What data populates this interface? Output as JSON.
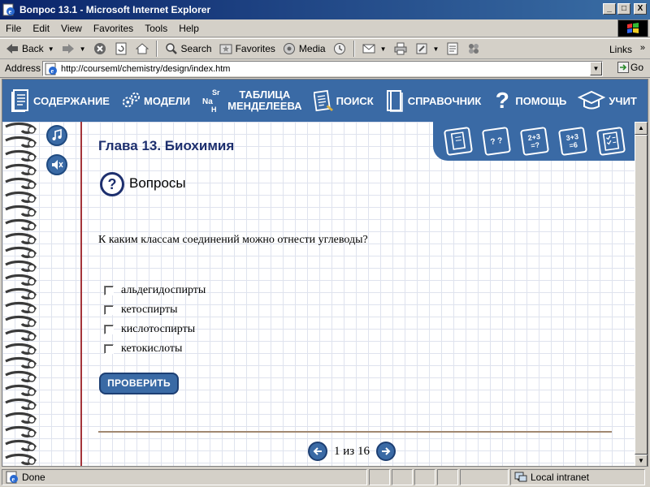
{
  "window": {
    "title": "Вопрос 13.1 - Microsoft Internet Explorer",
    "minimize": "_",
    "maximize": "□",
    "close": "X"
  },
  "menu": {
    "items": [
      "File",
      "Edit",
      "View",
      "Favorites",
      "Tools",
      "Help"
    ]
  },
  "toolbar": {
    "back": "Back",
    "search": "Search",
    "favorites": "Favorites",
    "media": "Media",
    "links": "Links"
  },
  "address": {
    "label": "Address",
    "url": "http://courseml/chemistry/design/index.htm",
    "go": "Go"
  },
  "nav": {
    "contents": "СОДЕРЖАНИЕ",
    "models": "МОДЕЛИ",
    "table_line1": "ТАБЛИЦА",
    "table_line2": "МЕНДЕЛЕЕВА",
    "search": "ПОИСК",
    "reference": "СПРАВОЧНИК",
    "help": "ПОМОЩЬ",
    "teacher": "УЧИТ",
    "elements_icon_text": "Sr Na H"
  },
  "corner_tools": {
    "quiz_icon_text": "? ?",
    "calc1": "2+3 =?",
    "calc2": "3+3 =6"
  },
  "content": {
    "chapter": "Глава 13. Биохимия",
    "section_icon": "?",
    "section": "Вопросы",
    "question": "К каким классам соединений можно отнести углеводы?",
    "options": [
      {
        "label": "альдегидоспирты",
        "checked": false
      },
      {
        "label": "кетоспирты",
        "checked": false
      },
      {
        "label": "кислотоспирты",
        "checked": false
      },
      {
        "label": "кетокислоты",
        "checked": false
      }
    ],
    "check_button": "ПРОВЕРИТЬ",
    "pager_text": "1 из 16",
    "pager_current": 1,
    "pager_total": 16
  },
  "status": {
    "text": "Done",
    "zone": "Local intranet"
  },
  "colors": {
    "accent_blue": "#3a6aa5",
    "heading_navy": "#1d2f6e",
    "margin_red": "#a4343a"
  },
  "icons": [
    "ie-page-icon",
    "back-arrow-icon",
    "forward-arrow-icon",
    "stop-icon",
    "refresh-icon",
    "home-icon",
    "search-icon",
    "favorites-icon",
    "media-icon",
    "history-icon",
    "mail-icon",
    "print-icon",
    "edit-icon",
    "discuss-icon",
    "messenger-icon",
    "book-icon",
    "gears-icon",
    "elements-icon",
    "document-icon",
    "help-question-icon",
    "graduation-cap-icon",
    "music-note-icon",
    "speaker-mute-icon",
    "question-circle-icon",
    "prev-arrow-icon",
    "next-arrow-icon",
    "intranet-icon"
  ]
}
